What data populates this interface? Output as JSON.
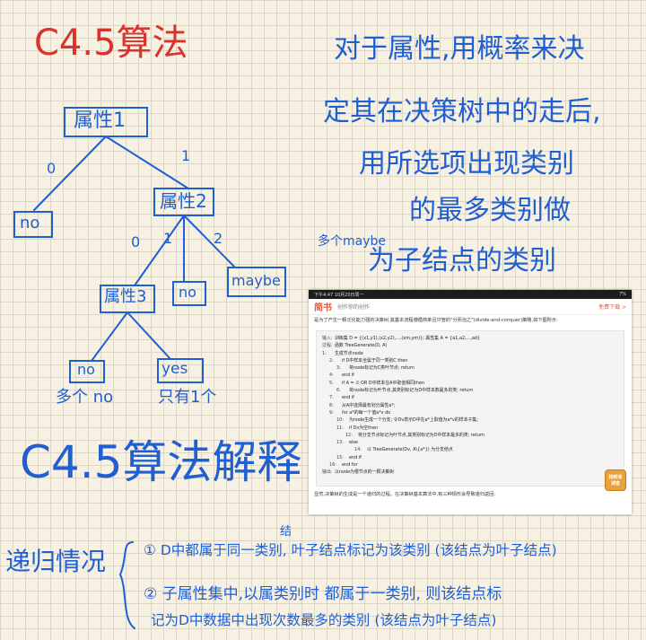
{
  "title": "C4.5算法",
  "title2": "C4.5算法解释",
  "note": {
    "line1": "对于属性,用概率来决",
    "line2": "定其在决策树中的走后,",
    "line3": "用所选项出现类别",
    "line4": "的最多类别做",
    "maybe_prefix": "多个maybe",
    "line5": "为子结点的类别"
  },
  "tree": {
    "attr1": "属性1",
    "attr2": "属性2",
    "attr3": "属性3",
    "edge0": "0",
    "edge1": "1",
    "edge0b": "0",
    "edge1b": "1",
    "edge2b": "2",
    "no1": "no",
    "no2": "no",
    "maybe": "maybe",
    "no3": "no",
    "yes": "yes",
    "cap_no": "多个 no",
    "cap_yes": "只有1个"
  },
  "cases": {
    "label": "递归情况",
    "c1": "① D中都属于同一类别, 叶子结点标记为该类别 (该结点为叶子结点)",
    "c1_insert": "结",
    "c2a": "② 子属性集中,以属类别时 都属于一类别, 则该结点标",
    "c2b": "记为D中数据中出现次数最多的类别 (该结点为叶子结点)"
  },
  "screenshot": {
    "status_left": "下午4:47  10月20日周一",
    "status_right": "7%",
    "logo": "简书",
    "subtitle": "创作你的创作",
    "download": "免费下载 >",
    "intro": "是为了产生一颗泛化能力强的决策树,其基本流程遵循简单且只管的\"分而治之\"(divide-and-conquer)策略,如下图所示:",
    "algo": [
      {
        "n": "输入:",
        "t": "训练集 D = {(x1,y1),(x2,y2),...,(xm,ym)}; 属性集 A = {a1,a2,...,ad}",
        "ind": "i0"
      },
      {
        "n": "过程:",
        "t": "函数 TreeGenerate(D, A)",
        "ind": "i0"
      },
      {
        "n": "1:",
        "t": "生成节点node",
        "ind": "i0"
      },
      {
        "n": "2:",
        "t": "if D中样本全属于同一类别C then",
        "ind": "i1"
      },
      {
        "n": "3:",
        "t": "将node标记为C类叶节点;  return",
        "ind": "i2"
      },
      {
        "n": "4:",
        "t": "end if",
        "ind": "i1"
      },
      {
        "n": "5:",
        "t": "if A = ∅  OR D中样本在A中取值相同then",
        "ind": "i1"
      },
      {
        "n": "6:",
        "t": "将node标记为叶节点,其类别标记为D中样本数最多的类;  return",
        "ind": "i2"
      },
      {
        "n": "7:",
        "t": "end if",
        "ind": "i1"
      },
      {
        "n": "8:",
        "t": "从A中选择最有划分属性a*;",
        "ind": "i1"
      },
      {
        "n": "9:",
        "t": "for a*的每一个值a*v  do",
        "ind": "i1"
      },
      {
        "n": "10:",
        "t": "为node生成一个分支; 令Dv表示D中在a*上取值为a*v的样本子集;",
        "ind": "i2"
      },
      {
        "n": "11:",
        "t": "if Dv为空then",
        "ind": "i2"
      },
      {
        "n": "12:",
        "t": "将分支节点标记为叶节点,其类别标记为D中样本最多的类;  return",
        "ind": "i3"
      },
      {
        "n": "13:",
        "t": "else",
        "ind": "i2"
      },
      {
        "n": "14:",
        "t": "以 TreeGenerate(Dv, A\\{a*}) 为分支结点",
        "ind": "i4"
      },
      {
        "n": "15:",
        "t": "end if",
        "ind": "i2"
      },
      {
        "n": "16:",
        "t": "end for",
        "ind": "i1"
      },
      {
        "n": "输出:",
        "t": "以node为根节点的一颗决策树",
        "ind": "i0"
      }
    ],
    "footer": "显然,决策树的生成是一个递归的过程。在决策树基本算法中,有三种情形会导致递归返回:",
    "badge_top": "抢鲜读",
    "badge_bottom": "调查"
  },
  "colors": {
    "red": "#d9342b",
    "blue": "#1f5fd1",
    "paper": "#f6f1e3"
  }
}
